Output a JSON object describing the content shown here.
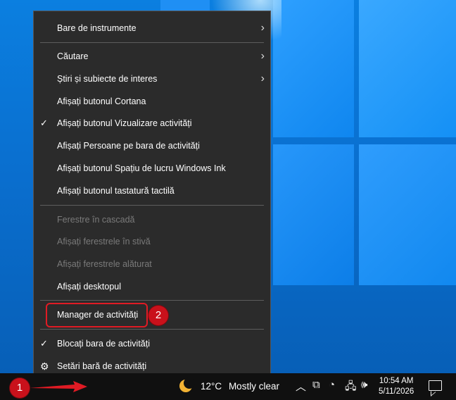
{
  "menu": {
    "items": [
      {
        "label": "Bare de instrumente",
        "submenu": true
      },
      {
        "label": "Căutare",
        "submenu": true
      },
      {
        "label": "Știri și subiecte de interes",
        "submenu": true
      },
      {
        "label": "Afișați butonul Cortana"
      },
      {
        "label": "Afișați butonul Vizualizare activități",
        "checked": true
      },
      {
        "label": "Afișați Persoane pe bara de activități"
      },
      {
        "label": "Afișați butonul Spațiu de lucru Windows Ink"
      },
      {
        "label": "Afișați butonul tastatură tactilă"
      },
      {
        "label": "Ferestre în cascadă",
        "disabled": true
      },
      {
        "label": "Afișați ferestrele în stivă",
        "disabled": true
      },
      {
        "label": "Afișați ferestrele alăturat",
        "disabled": true
      },
      {
        "label": "Afișați desktopul"
      },
      {
        "label": "Manager de activități",
        "highlighted": true
      },
      {
        "label": "Blocați bara de activități",
        "checked": true
      },
      {
        "label": "Setări bară de activități",
        "icon": "gear-icon"
      }
    ],
    "chevron": "›",
    "check": "✓",
    "gear": "⚙"
  },
  "annotations": {
    "step1": "1",
    "step2": "2",
    "highlight_color": "#e01b24"
  },
  "taskbar": {
    "weather": {
      "temp": "12°C",
      "condition": "Mostly clear",
      "icon": "moon-icon"
    },
    "tray_icons": [
      "chevron-up-icon",
      "meet-now-icon",
      "edge-sync-icon",
      "network-icon",
      "volume-icon"
    ],
    "tray_glyphs": [
      "︿",
      "⧉",
      "◔",
      "🖧",
      "🕪"
    ],
    "time": "10:54 AM",
    "date": "5/11/2026",
    "notification_icon": "notification-icon"
  }
}
